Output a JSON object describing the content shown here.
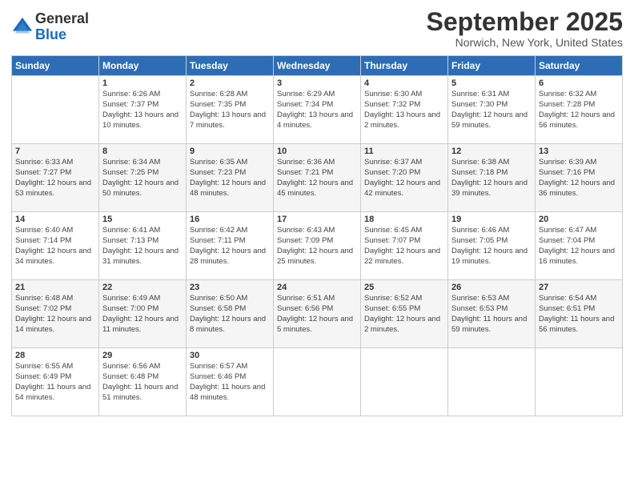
{
  "header": {
    "logo_general": "General",
    "logo_blue": "Blue",
    "month": "September 2025",
    "location": "Norwich, New York, United States"
  },
  "days_of_week": [
    "Sunday",
    "Monday",
    "Tuesday",
    "Wednesday",
    "Thursday",
    "Friday",
    "Saturday"
  ],
  "weeks": [
    [
      {
        "day": "",
        "sunrise": "",
        "sunset": "",
        "daylight": ""
      },
      {
        "day": "1",
        "sunrise": "Sunrise: 6:26 AM",
        "sunset": "Sunset: 7:37 PM",
        "daylight": "Daylight: 13 hours and 10 minutes."
      },
      {
        "day": "2",
        "sunrise": "Sunrise: 6:28 AM",
        "sunset": "Sunset: 7:35 PM",
        "daylight": "Daylight: 13 hours and 7 minutes."
      },
      {
        "day": "3",
        "sunrise": "Sunrise: 6:29 AM",
        "sunset": "Sunset: 7:34 PM",
        "daylight": "Daylight: 13 hours and 4 minutes."
      },
      {
        "day": "4",
        "sunrise": "Sunrise: 6:30 AM",
        "sunset": "Sunset: 7:32 PM",
        "daylight": "Daylight: 13 hours and 2 minutes."
      },
      {
        "day": "5",
        "sunrise": "Sunrise: 6:31 AM",
        "sunset": "Sunset: 7:30 PM",
        "daylight": "Daylight: 12 hours and 59 minutes."
      },
      {
        "day": "6",
        "sunrise": "Sunrise: 6:32 AM",
        "sunset": "Sunset: 7:28 PM",
        "daylight": "Daylight: 12 hours and 56 minutes."
      }
    ],
    [
      {
        "day": "7",
        "sunrise": "Sunrise: 6:33 AM",
        "sunset": "Sunset: 7:27 PM",
        "daylight": "Daylight: 12 hours and 53 minutes."
      },
      {
        "day": "8",
        "sunrise": "Sunrise: 6:34 AM",
        "sunset": "Sunset: 7:25 PM",
        "daylight": "Daylight: 12 hours and 50 minutes."
      },
      {
        "day": "9",
        "sunrise": "Sunrise: 6:35 AM",
        "sunset": "Sunset: 7:23 PM",
        "daylight": "Daylight: 12 hours and 48 minutes."
      },
      {
        "day": "10",
        "sunrise": "Sunrise: 6:36 AM",
        "sunset": "Sunset: 7:21 PM",
        "daylight": "Daylight: 12 hours and 45 minutes."
      },
      {
        "day": "11",
        "sunrise": "Sunrise: 6:37 AM",
        "sunset": "Sunset: 7:20 PM",
        "daylight": "Daylight: 12 hours and 42 minutes."
      },
      {
        "day": "12",
        "sunrise": "Sunrise: 6:38 AM",
        "sunset": "Sunset: 7:18 PM",
        "daylight": "Daylight: 12 hours and 39 minutes."
      },
      {
        "day": "13",
        "sunrise": "Sunrise: 6:39 AM",
        "sunset": "Sunset: 7:16 PM",
        "daylight": "Daylight: 12 hours and 36 minutes."
      }
    ],
    [
      {
        "day": "14",
        "sunrise": "Sunrise: 6:40 AM",
        "sunset": "Sunset: 7:14 PM",
        "daylight": "Daylight: 12 hours and 34 minutes."
      },
      {
        "day": "15",
        "sunrise": "Sunrise: 6:41 AM",
        "sunset": "Sunset: 7:13 PM",
        "daylight": "Daylight: 12 hours and 31 minutes."
      },
      {
        "day": "16",
        "sunrise": "Sunrise: 6:42 AM",
        "sunset": "Sunset: 7:11 PM",
        "daylight": "Daylight: 12 hours and 28 minutes."
      },
      {
        "day": "17",
        "sunrise": "Sunrise: 6:43 AM",
        "sunset": "Sunset: 7:09 PM",
        "daylight": "Daylight: 12 hours and 25 minutes."
      },
      {
        "day": "18",
        "sunrise": "Sunrise: 6:45 AM",
        "sunset": "Sunset: 7:07 PM",
        "daylight": "Daylight: 12 hours and 22 minutes."
      },
      {
        "day": "19",
        "sunrise": "Sunrise: 6:46 AM",
        "sunset": "Sunset: 7:05 PM",
        "daylight": "Daylight: 12 hours and 19 minutes."
      },
      {
        "day": "20",
        "sunrise": "Sunrise: 6:47 AM",
        "sunset": "Sunset: 7:04 PM",
        "daylight": "Daylight: 12 hours and 16 minutes."
      }
    ],
    [
      {
        "day": "21",
        "sunrise": "Sunrise: 6:48 AM",
        "sunset": "Sunset: 7:02 PM",
        "daylight": "Daylight: 12 hours and 14 minutes."
      },
      {
        "day": "22",
        "sunrise": "Sunrise: 6:49 AM",
        "sunset": "Sunset: 7:00 PM",
        "daylight": "Daylight: 12 hours and 11 minutes."
      },
      {
        "day": "23",
        "sunrise": "Sunrise: 6:50 AM",
        "sunset": "Sunset: 6:58 PM",
        "daylight": "Daylight: 12 hours and 8 minutes."
      },
      {
        "day": "24",
        "sunrise": "Sunrise: 6:51 AM",
        "sunset": "Sunset: 6:56 PM",
        "daylight": "Daylight: 12 hours and 5 minutes."
      },
      {
        "day": "25",
        "sunrise": "Sunrise: 6:52 AM",
        "sunset": "Sunset: 6:55 PM",
        "daylight": "Daylight: 12 hours and 2 minutes."
      },
      {
        "day": "26",
        "sunrise": "Sunrise: 6:53 AM",
        "sunset": "Sunset: 6:53 PM",
        "daylight": "Daylight: 11 hours and 59 minutes."
      },
      {
        "day": "27",
        "sunrise": "Sunrise: 6:54 AM",
        "sunset": "Sunset: 6:51 PM",
        "daylight": "Daylight: 11 hours and 56 minutes."
      }
    ],
    [
      {
        "day": "28",
        "sunrise": "Sunrise: 6:55 AM",
        "sunset": "Sunset: 6:49 PM",
        "daylight": "Daylight: 11 hours and 54 minutes."
      },
      {
        "day": "29",
        "sunrise": "Sunrise: 6:56 AM",
        "sunset": "Sunset: 6:48 PM",
        "daylight": "Daylight: 11 hours and 51 minutes."
      },
      {
        "day": "30",
        "sunrise": "Sunrise: 6:57 AM",
        "sunset": "Sunset: 6:46 PM",
        "daylight": "Daylight: 11 hours and 48 minutes."
      },
      {
        "day": "",
        "sunrise": "",
        "sunset": "",
        "daylight": ""
      },
      {
        "day": "",
        "sunrise": "",
        "sunset": "",
        "daylight": ""
      },
      {
        "day": "",
        "sunrise": "",
        "sunset": "",
        "daylight": ""
      },
      {
        "day": "",
        "sunrise": "",
        "sunset": "",
        "daylight": ""
      }
    ]
  ]
}
